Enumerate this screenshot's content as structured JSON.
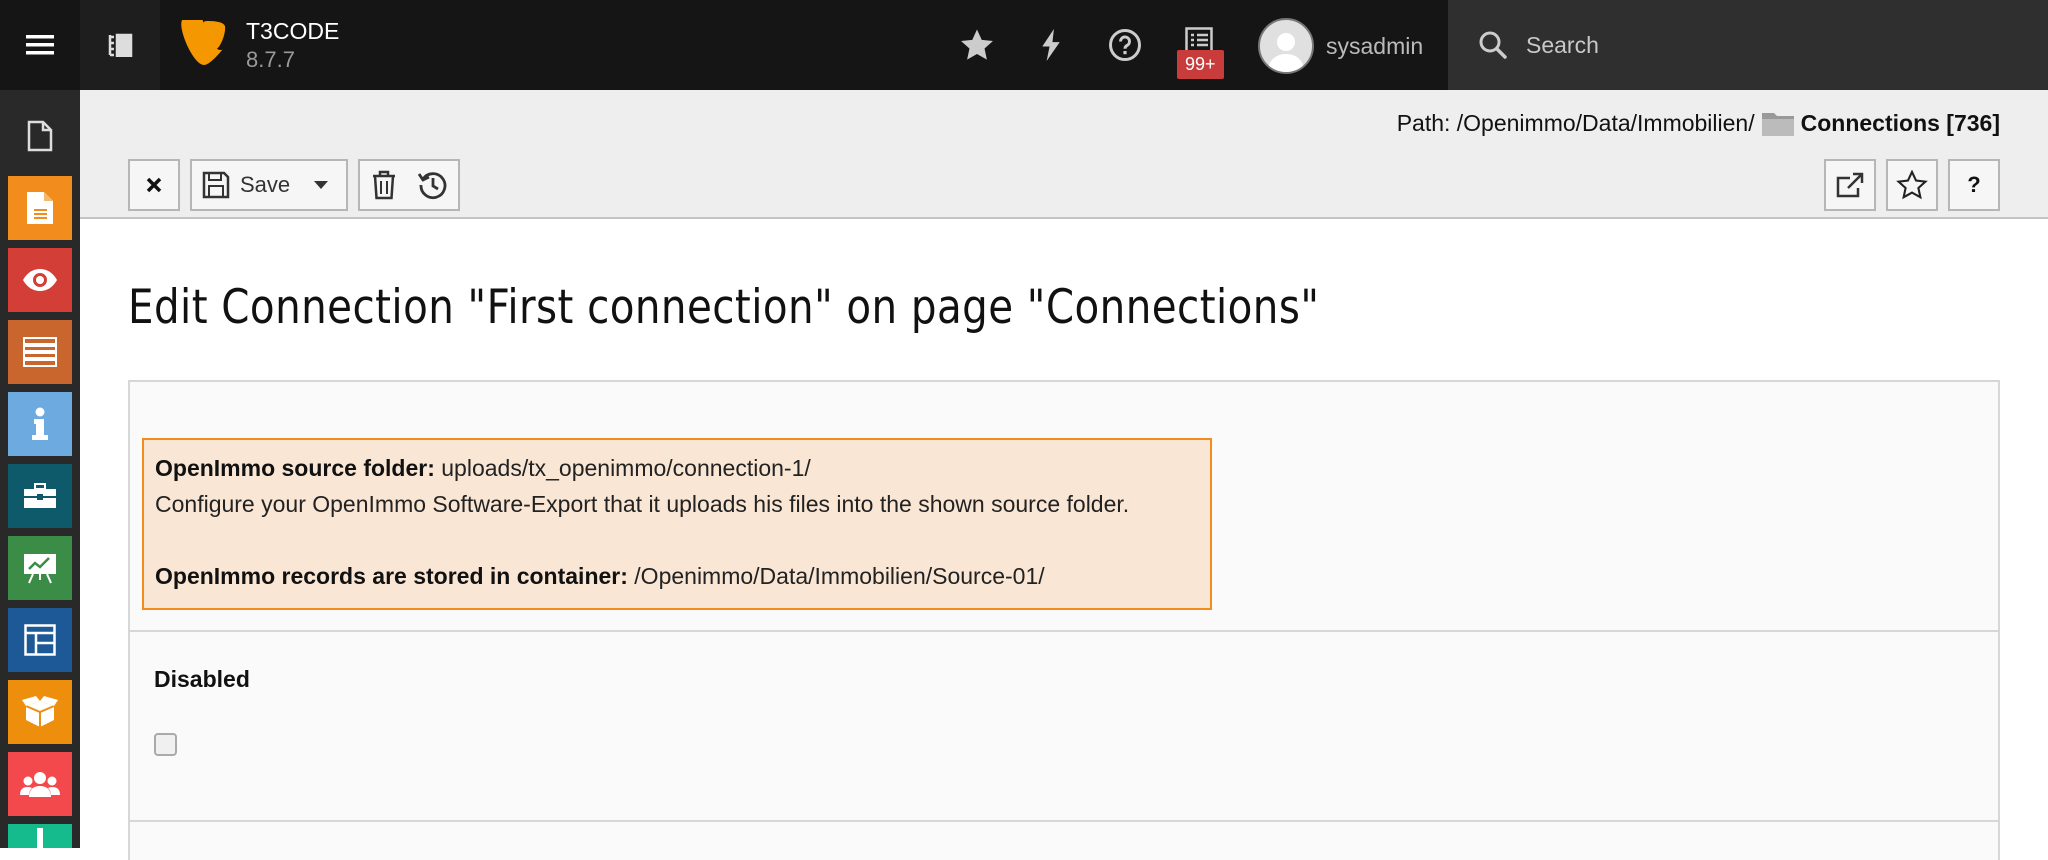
{
  "topbar": {
    "site_name": "T3CODE",
    "site_version": "8.7.7",
    "badge_count": "99+",
    "username": "sysadmin",
    "search_placeholder": "Search"
  },
  "sidebar": {
    "items": [
      {
        "name": "page-module",
        "icon": "page-icon",
        "color": "#f28c1c"
      },
      {
        "name": "view-module",
        "icon": "eye-icon",
        "color": "#d33f37"
      },
      {
        "name": "list-module",
        "icon": "list-icon",
        "color": "#c8662e"
      },
      {
        "name": "info-module",
        "icon": "info-icon",
        "color": "#6daae0"
      },
      {
        "name": "openimmo-module",
        "icon": "briefcase-icon",
        "color": "#0e5a6b"
      },
      {
        "name": "reports-module",
        "icon": "chart-board-icon",
        "color": "#3b8c47"
      },
      {
        "name": "template-module",
        "icon": "layout-icon",
        "color": "#1c5996"
      },
      {
        "name": "extensions-module",
        "icon": "box-icon",
        "color": "#ee8e0d"
      },
      {
        "name": "users-module",
        "icon": "users-icon",
        "color": "#f3494d"
      },
      {
        "name": "import-module",
        "icon": "download-icon",
        "color": "#16bb8d"
      }
    ]
  },
  "docheader": {
    "path_prefix": "Path: /Openimmo/Data/Immobilien/",
    "path_title": "Connections [736]",
    "save_label": "Save",
    "help_label": "?"
  },
  "form": {
    "heading": "Edit Connection \"First connection\" on page \"Connections\"",
    "info": {
      "source_folder_label": "OpenImmo source folder:",
      "source_folder_value": " uploads/tx_openimmo/connection-1/",
      "configure_text": "Configure your OpenImmo Software-Export that it uploads his files into the shown source folder.",
      "container_label": "OpenImmo records are stored in container:",
      "container_value": " /Openimmo/Data/Immobilien/Source-01/"
    },
    "disabled_label": "Disabled",
    "disabled_checked": false
  },
  "colors": {
    "accent_orange": "#f28c1c",
    "badge_red": "#c83c3c"
  }
}
